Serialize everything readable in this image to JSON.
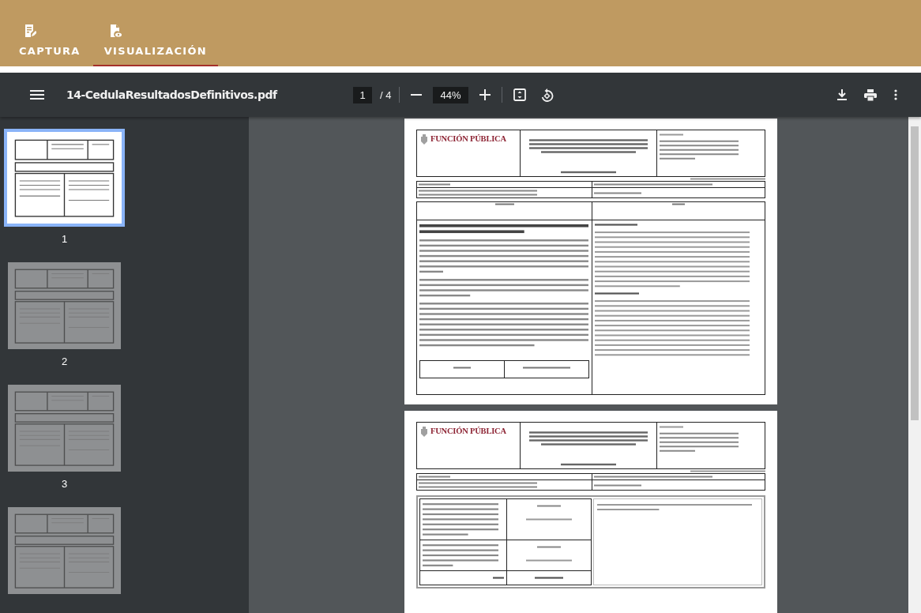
{
  "app_tabs": [
    {
      "label": "CAPTURA",
      "kind": "capture",
      "selected": false
    },
    {
      "label": "VISUALIZACIÓN",
      "kind": "view",
      "selected": true
    }
  ],
  "viewer": {
    "file_name": "14-CedulaResultadosDefinitivos.pdf",
    "page_current": "1",
    "page_total": "/ 4",
    "zoom": "44%"
  },
  "thumbnails": [
    {
      "label": "1",
      "selected": true
    },
    {
      "label": "2",
      "selected": false
    },
    {
      "label": "3",
      "selected": false
    },
    {
      "selected": false
    }
  ],
  "pages": [
    {
      "logo": "FUNCIÓN PÚBLICA",
      "kind": "results"
    },
    {
      "logo": "FUNCIÓN PÚBLICA",
      "kind": "contracts"
    }
  ]
}
